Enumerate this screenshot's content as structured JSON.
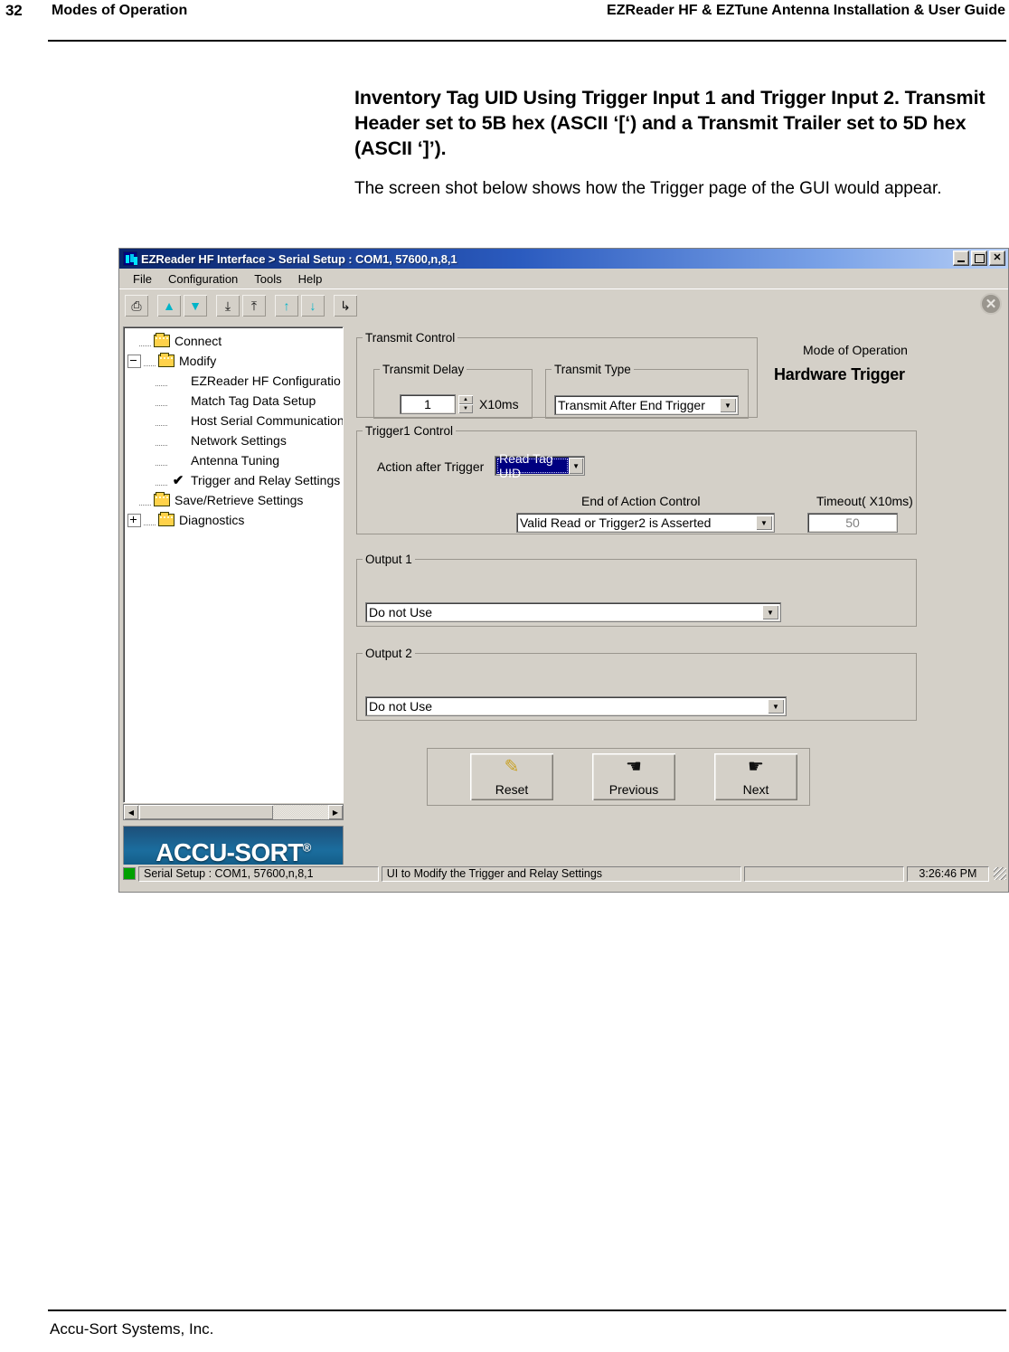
{
  "document": {
    "page_number": "32",
    "section_title": "Modes of Operation",
    "guide_title": "EZReader HF & EZTune Antenna Installation & User Guide",
    "heading": "Inventory Tag UID Using Trigger Input 1 and Trigger Input 2. Transmit Header set to 5B hex (ASCII ‘[‘) and a Transmit Trailer set to 5D hex (ASCII ‘]’).",
    "paragraph": "The screen shot below shows how the Trigger page of the GUI would appear.",
    "footer": "Accu-Sort Systems, Inc."
  },
  "app": {
    "title": "EZReader HF Interface > Serial Setup : COM1, 57600,n,8,1",
    "title_icon": "app-icon",
    "window_buttons": [
      {
        "name": "minimize",
        "glyph": "–"
      },
      {
        "name": "maximize",
        "glyph": "□"
      },
      {
        "name": "close",
        "glyph": "✕"
      }
    ],
    "menu": [
      "File",
      "Configuration",
      "Tools",
      "Help"
    ],
    "toolbar": {
      "buttons": [
        {
          "name": "save-settings-icon",
          "glyph": "⎙"
        },
        {
          "name": "upload-arrow-up-icon",
          "glyph": "▲"
        },
        {
          "name": "download-arrow-down-icon",
          "glyph": "▼"
        },
        {
          "name": "read-device-down-icon",
          "glyph": "⤓"
        },
        {
          "name": "write-device-up-icon",
          "glyph": "⤒"
        },
        {
          "name": "user-upload-icon",
          "glyph": "↑"
        },
        {
          "name": "user-download-icon",
          "glyph": "↓"
        },
        {
          "name": "pointer-tool-icon",
          "glyph": "↳"
        }
      ],
      "close_button": "✕"
    },
    "tree": [
      {
        "label": "Connect",
        "icon": "folder-icon",
        "indent": 1,
        "expander": "none",
        "checked": false
      },
      {
        "label": "Modify",
        "icon": "folder-icon",
        "indent": 0,
        "expander": "minus",
        "checked": false
      },
      {
        "label": "EZReader HF Configuratio",
        "icon": "none",
        "indent": 2,
        "expander": "none",
        "checked": false
      },
      {
        "label": "Match Tag Data Setup",
        "icon": "none",
        "indent": 2,
        "expander": "none",
        "checked": false
      },
      {
        "label": "Host Serial Communication",
        "icon": "none",
        "indent": 2,
        "expander": "none",
        "checked": false
      },
      {
        "label": "Network Settings",
        "icon": "none",
        "indent": 2,
        "expander": "none",
        "checked": false
      },
      {
        "label": "Antenna Tuning",
        "icon": "none",
        "indent": 2,
        "expander": "none",
        "checked": false
      },
      {
        "label": "Trigger and Relay Settings",
        "icon": "check-icon",
        "indent": 2,
        "expander": "none",
        "checked": true
      },
      {
        "label": "Save/Retrieve Settings",
        "icon": "folder-icon",
        "indent": 1,
        "expander": "none",
        "checked": false
      },
      {
        "label": "Diagnostics",
        "icon": "folder-icon",
        "indent": 0,
        "expander": "plus",
        "checked": false
      }
    ],
    "logo": "ACCU-SORT",
    "logo_mark": "®",
    "panels": {
      "transmit_control": {
        "legend": "Transmit Control",
        "transmit_delay": {
          "legend": "Transmit Delay",
          "value": "1",
          "unit": "X10ms",
          "spin_up": "▲",
          "spin_down": "▼"
        },
        "transmit_type": {
          "legend": "Transmit Type",
          "value": "Transmit After End Trigger"
        }
      },
      "mode_of_operation": {
        "label": "Mode of Operation",
        "value": "Hardware Trigger"
      },
      "trigger1_control": {
        "legend": "Trigger1 Control",
        "action_after_trigger_label": "Action after Trigger",
        "action_after_trigger_value": "Read Tag UID",
        "end_of_action_label": "End of Action Control",
        "end_of_action_value": "Valid Read or Trigger2 is Asserted",
        "timeout_label": "Timeout( X10ms)",
        "timeout_value": "50"
      },
      "output1": {
        "legend": "Output 1",
        "value": "Do not Use"
      },
      "output2": {
        "legend": "Output 2",
        "value": "Do not Use"
      }
    },
    "nav_buttons": [
      {
        "label": "Reset",
        "icon": "pencil-eraser-icon",
        "glyph": "✎"
      },
      {
        "label": "Previous",
        "icon": "hand-pointing-left-icon",
        "glyph": "☚"
      },
      {
        "label": "Next",
        "icon": "hand-pointing-right-icon",
        "glyph": "☛"
      }
    ],
    "statusbar": {
      "led_color": "#00a000",
      "connection": "Serial Setup : COM1, 57600,n,8,1",
      "message": "UI to Modify the Trigger and Relay Settings",
      "progress": "",
      "time": "3:26:46 PM"
    }
  },
  "colors": {
    "window_face": "#d4d0c8",
    "title_start": "#0a246a",
    "title_end": "#b6cef5",
    "selection_navy": "#000080",
    "led_green": "#00a000",
    "logo_blue": "#1b6d9e"
  }
}
